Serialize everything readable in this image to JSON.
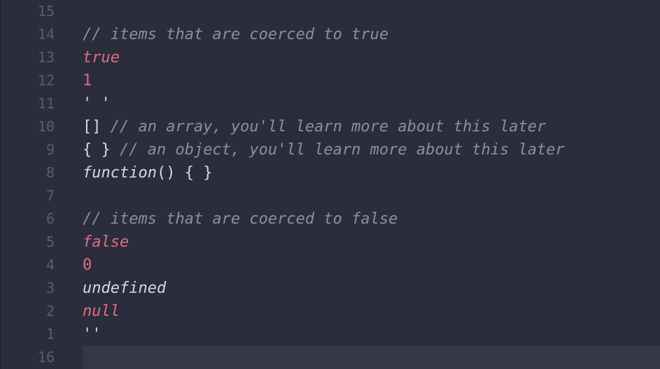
{
  "editor": {
    "lines": [
      {
        "num": "15",
        "tokens": []
      },
      {
        "num": "14",
        "tokens": [
          {
            "text": "// items that are coerced to true",
            "kind": "comment"
          }
        ]
      },
      {
        "num": "13",
        "tokens": [
          {
            "text": "true",
            "kind": "keyword"
          }
        ]
      },
      {
        "num": "12",
        "tokens": [
          {
            "text": "1",
            "kind": "number"
          }
        ]
      },
      {
        "num": "11",
        "tokens": [
          {
            "text": "' '",
            "kind": "str"
          }
        ]
      },
      {
        "num": "10",
        "tokens": [
          {
            "text": "[] ",
            "kind": "plain"
          },
          {
            "text": "// an array, you'll learn more about this later",
            "kind": "comment"
          }
        ]
      },
      {
        "num": "9",
        "tokens": [
          {
            "text": "{ } ",
            "kind": "plain"
          },
          {
            "text": "// an object, you'll learn more about this later",
            "kind": "comment"
          }
        ]
      },
      {
        "num": "8",
        "tokens": [
          {
            "text": "function",
            "kind": "ident"
          },
          {
            "text": "() { }",
            "kind": "plain"
          }
        ]
      },
      {
        "num": "7",
        "tokens": []
      },
      {
        "num": "6",
        "tokens": [
          {
            "text": "// items that are coerced to false",
            "kind": "comment"
          }
        ]
      },
      {
        "num": "5",
        "tokens": [
          {
            "text": "false",
            "kind": "keyword"
          }
        ]
      },
      {
        "num": "4",
        "tokens": [
          {
            "text": "0",
            "kind": "number"
          }
        ]
      },
      {
        "num": "3",
        "tokens": [
          {
            "text": "undefined",
            "kind": "ident"
          }
        ]
      },
      {
        "num": "2",
        "tokens": [
          {
            "text": "null",
            "kind": "keyword"
          }
        ]
      },
      {
        "num": "1",
        "tokens": [
          {
            "text": "''",
            "kind": "str"
          }
        ]
      },
      {
        "num": "16",
        "tokens": [],
        "current": true
      }
    ]
  },
  "colors": {
    "background": "#2b2d3c",
    "current_line": "#353746",
    "comment": "#8c8ea3",
    "keyword": "#e06c85",
    "text": "#d7d8e5",
    "gutter": "#5a5d70"
  }
}
